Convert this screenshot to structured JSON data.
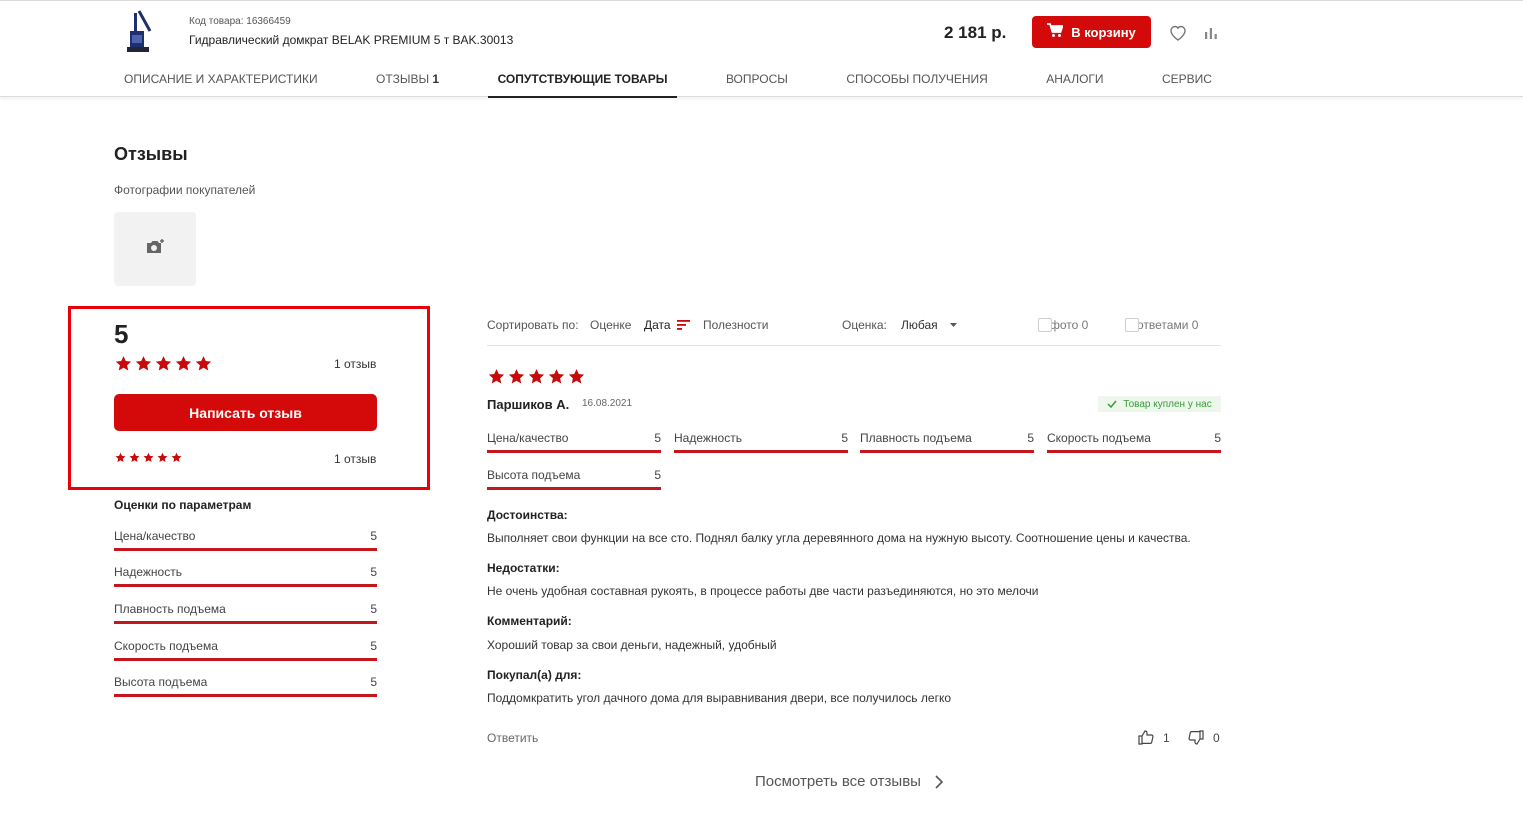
{
  "product": {
    "code_label": "Код товара: 16366459",
    "name": "Гидравлический домкрат BELAK PREMIUM 5 т BAK.30013",
    "price": "2 181 р.",
    "cart_label": "В корзину"
  },
  "tabs": [
    {
      "label": "ОПИСАНИЕ И ХАРАКТЕРИСТИКИ",
      "count": ""
    },
    {
      "label": "ОТЗЫВЫ",
      "count": "1"
    },
    {
      "label": "СОПУТСТВУЮЩИЕ ТОВАРЫ",
      "count": ""
    },
    {
      "label": "ВОПРОСЫ",
      "count": ""
    },
    {
      "label": "СПОСОБЫ ПОЛУЧЕНИЯ",
      "count": ""
    },
    {
      "label": "АНАЛОГИ",
      "count": ""
    },
    {
      "label": "СЕРВИС",
      "count": ""
    }
  ],
  "reviews": {
    "title": "Отзывы",
    "photos_label": "Фотографии покупателей",
    "average": "5",
    "rating_stars": 5,
    "total_count": "1 отзыв",
    "write_button": "Написать отзыв",
    "breakdown_count": "1 отзыв",
    "params_title": "Оценки по параметрам",
    "params": [
      {
        "label": "Цена/качество",
        "value": "5"
      },
      {
        "label": "Надежность",
        "value": "5"
      },
      {
        "label": "Плавность подъема",
        "value": "5"
      },
      {
        "label": "Скорость подъема",
        "value": "5"
      },
      {
        "label": "Высота подъема",
        "value": "5"
      }
    ]
  },
  "sort": {
    "label": "Сортировать по:",
    "by_rating": "Оценке",
    "by_date": "Дата",
    "by_usefulness": "Полезности",
    "rating_label": "Оценка:",
    "rating_value": "Любая",
    "with_photo": "С фото 0",
    "with_answers": "С ответами 0"
  },
  "review": {
    "stars": 5,
    "author": "Паршиков А.",
    "date": "16.08.2021",
    "badge": "Товар куплен у нас",
    "params": [
      {
        "label": "Цена/качество",
        "value": "5"
      },
      {
        "label": "Надежность",
        "value": "5"
      },
      {
        "label": "Плавность подъема",
        "value": "5"
      },
      {
        "label": "Скорость подъема",
        "value": "5"
      },
      {
        "label": "Высота подъема",
        "value": "5"
      }
    ],
    "pros_label": "Достоинства:",
    "pros": "Выполняет свои функции на все сто. Поднял балку угла деревянного дома на нужную высоту. Соотношение цены и качества.",
    "cons_label": "Недостатки:",
    "cons": "Не очень удобная составная рукоять, в процессе работы две части разъединяются, но это мелочи",
    "comment_label": "Комментарий:",
    "comment": "Хороший товар за свои деньги, надежный, удобный",
    "purpose_label": "Покупал(а) для:",
    "purpose": "Поддомкратить угол дачного дома для выравнивания двери, все получилось легко",
    "reply": "Ответить",
    "likes": "1",
    "dislikes": "0"
  },
  "all_reviews_link": "Посмотреть все отзывы",
  "colors": {
    "accent": "#d40a0a",
    "highlight_frame": "#e8000b",
    "bar": "#c4161c",
    "badge_green": "#3a9a3a"
  }
}
